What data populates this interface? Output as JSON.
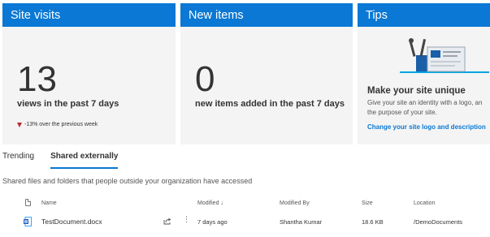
{
  "cards": {
    "site_visits": {
      "title": "Site visits",
      "value": "13",
      "caption": "views in the past 7 days",
      "trend": "-13% over the previous week"
    },
    "new_items": {
      "title": "New items",
      "value": "0",
      "caption": "new items added in the past 7 days"
    },
    "tips": {
      "title": "Tips",
      "heading": "Make your site unique",
      "desc_line1": "Give your site an identity with a logo, an",
      "desc_line2": "the purpose of your site.",
      "link": "Change your site logo and description"
    }
  },
  "tabs": [
    {
      "label": "Trending"
    },
    {
      "label": "Shared externally"
    }
  ],
  "section_description": "Shared files and folders that people outside your organization have accessed",
  "table": {
    "columns": {
      "name": "Name",
      "modified": "Modified",
      "modified_sort": "↓",
      "modified_by": "Modified By",
      "size": "Size",
      "location": "Location"
    },
    "rows": [
      {
        "name": "TestDocument.docx",
        "more": "⋮",
        "modified": "7 days ago",
        "modified_by": "Shantha Kumar",
        "size": "18.6 KB",
        "location": "/DemoDocuments"
      }
    ]
  },
  "colors": {
    "accent": "#0a78d4",
    "card_bg": "#f4f4f4",
    "trend_down": "#c0272d"
  },
  "icons": [
    "trend-down-arrow-icon",
    "tips-illustration-icon",
    "file-header-icon",
    "word-document-icon",
    "share-icon",
    "more-options-icon"
  ]
}
